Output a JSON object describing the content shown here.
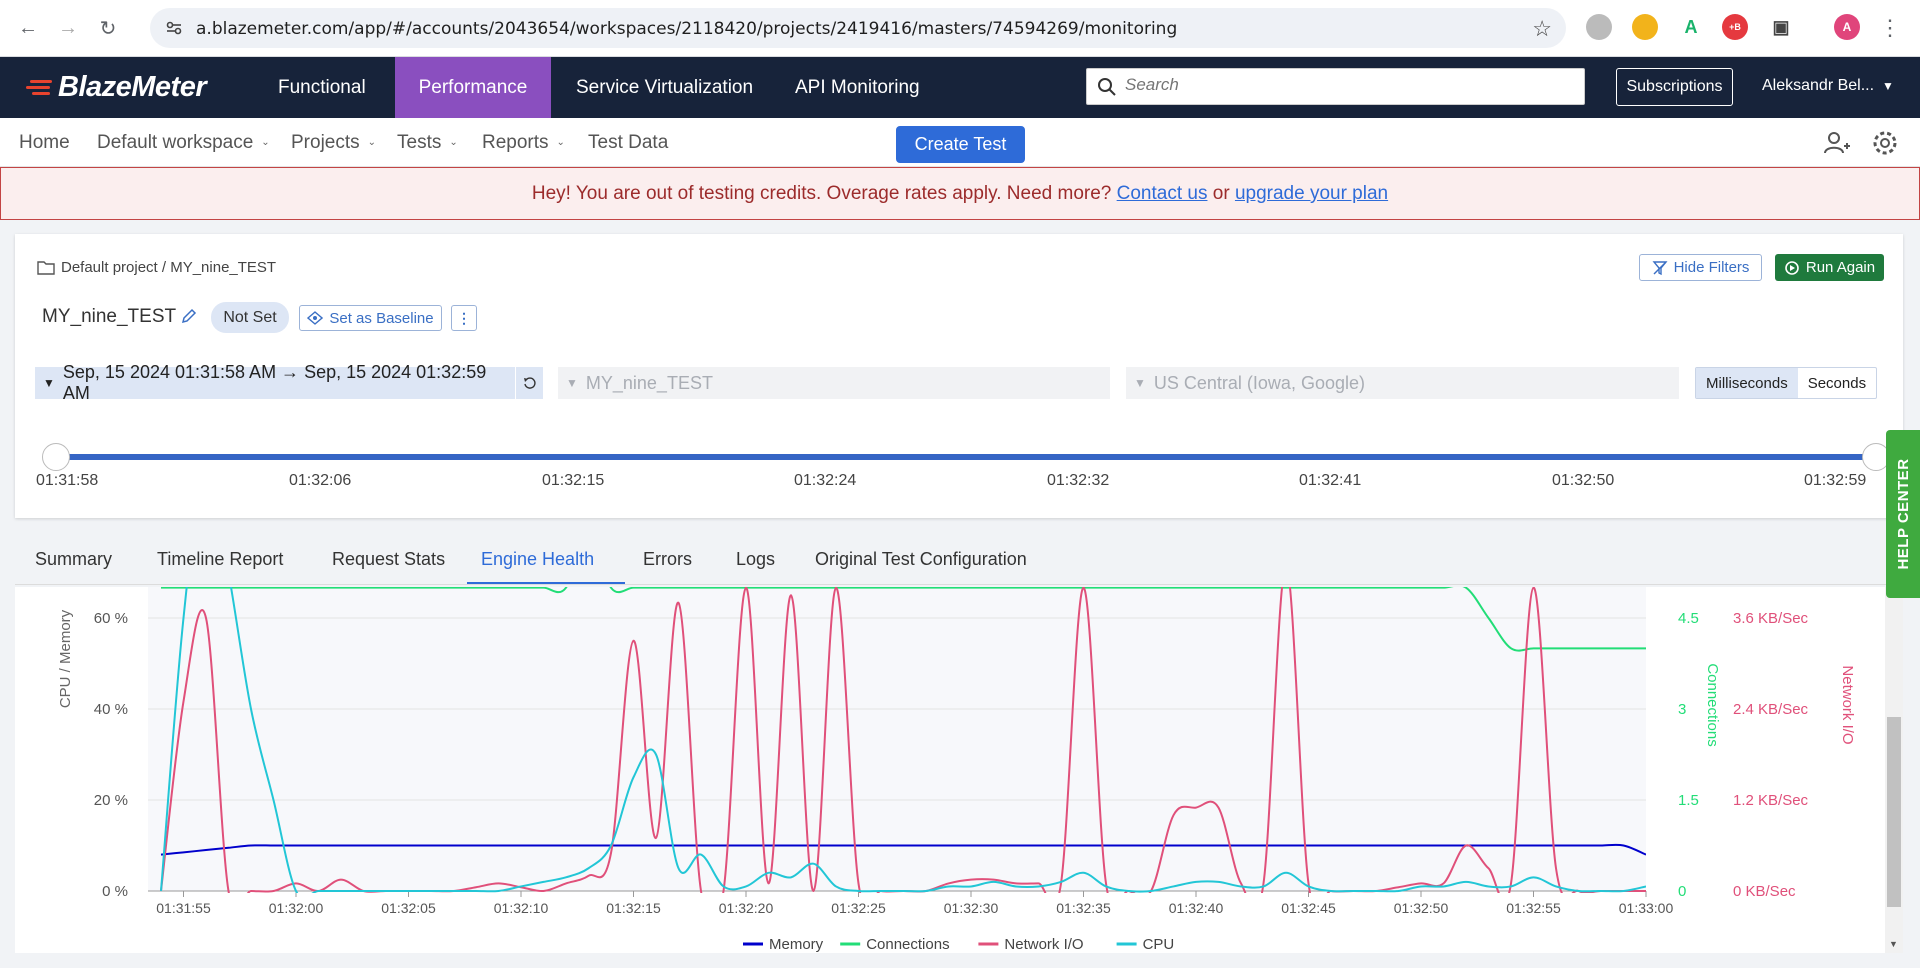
{
  "browser": {
    "url": "a.blazemeter.com/app/#/accounts/2043654/workspaces/2118420/projects/2419416/masters/74594269/monitoring",
    "profile_initial": "A"
  },
  "topnav": {
    "brand": "BlazeMeter",
    "items": [
      {
        "label": "Functional"
      },
      {
        "label": "Performance"
      },
      {
        "label": "Service Virtualization"
      },
      {
        "label": "API Monitoring"
      }
    ],
    "search_placeholder": "Search",
    "subscriptions_label": "Subscriptions",
    "user_name": "Aleksandr Bel...",
    "active_color": "#8a4fbf",
    "bg_color": "#17233a"
  },
  "subnav": {
    "home": "Home",
    "workspace": "Default workspace",
    "projects": "Projects",
    "tests": "Tests",
    "reports": "Reports",
    "test_data": "Test Data",
    "create_test": "Create Test"
  },
  "banner": {
    "text": "Hey! You are out of testing credits. Overage rates apply. Need more?",
    "contact_link": "Contact us",
    "or": "or",
    "upgrade_link": "upgrade your plan"
  },
  "test": {
    "breadcrumb": "Default project / MY_nine_TEST",
    "hide_filters": "Hide Filters",
    "run_again": "Run Again",
    "name": "MY_nine_TEST",
    "status": "Not Set",
    "set_baseline": "Set as Baseline",
    "date_range": "Sep, 15 2024 01:31:58 AM → Sep, 15 2024 01:32:59 AM",
    "scenario": "MY_nine_TEST",
    "location": "US Central (Iowa, Google)",
    "unit_ms": "Milliseconds",
    "unit_s": "Seconds",
    "slider_ticks": [
      "01:31:58",
      "01:32:06",
      "01:32:15",
      "01:32:24",
      "01:32:32",
      "01:32:41",
      "01:32:50",
      "01:32:59"
    ]
  },
  "tabs": [
    {
      "label": "Summary"
    },
    {
      "label": "Timeline Report"
    },
    {
      "label": "Request Stats"
    },
    {
      "label": "Engine Health"
    },
    {
      "label": "Errors"
    },
    {
      "label": "Logs"
    },
    {
      "label": "Original Test Configuration"
    }
  ],
  "help_center": "HELP CENTER",
  "chart_data": {
    "type": "line",
    "x": [
      "01:31:54",
      "01:31:55",
      "01:31:56",
      "01:31:57",
      "01:31:58",
      "01:31:59",
      "01:32:00",
      "01:32:01",
      "01:32:02",
      "01:32:03",
      "01:32:04",
      "01:32:05",
      "01:32:06",
      "01:32:07",
      "01:32:08",
      "01:32:09",
      "01:32:10",
      "01:32:11",
      "01:32:12",
      "01:32:13",
      "01:32:14",
      "01:32:15",
      "01:32:16",
      "01:32:17",
      "01:32:18",
      "01:32:19",
      "01:32:20",
      "01:32:21",
      "01:32:22",
      "01:32:23",
      "01:32:24",
      "01:32:25",
      "01:32:26",
      "01:32:27",
      "01:32:28",
      "01:32:29",
      "01:32:30",
      "01:32:31",
      "01:32:32",
      "01:32:33",
      "01:32:34",
      "01:32:35",
      "01:32:36",
      "01:32:37",
      "01:32:38",
      "01:32:39",
      "01:32:40",
      "01:32:41",
      "01:32:42",
      "01:32:43",
      "01:32:44",
      "01:32:45",
      "01:32:46",
      "01:32:47",
      "01:32:48",
      "01:32:49",
      "01:32:50",
      "01:32:51",
      "01:32:52",
      "01:32:53",
      "01:32:54",
      "01:32:55",
      "01:32:56",
      "01:32:57",
      "01:32:58",
      "01:32:59",
      "01:33:00"
    ],
    "x_ticks": [
      "01:31:55",
      "01:32:00",
      "01:32:05",
      "01:32:10",
      "01:32:15",
      "01:32:20",
      "01:32:25",
      "01:32:30",
      "01:32:35",
      "01:32:40",
      "01:32:45",
      "01:32:50",
      "01:32:55",
      "01:33:00"
    ],
    "y_left": {
      "label": "CPU / Memory",
      "ticks": [
        "0 %",
        "20 %",
        "40 %",
        "60 %"
      ],
      "range": [
        0,
        80
      ]
    },
    "y_right_connections": {
      "label": "Connections",
      "ticks": [
        "0",
        "1.5",
        "3",
        "4.5"
      ],
      "range": [
        0,
        6
      ]
    },
    "y_right_network": {
      "label": "Network I/O",
      "ticks": [
        "0 KB/Sec",
        "1.2 KB/Sec",
        "2.4 KB/Sec",
        "3.6 KB/Sec"
      ],
      "range": [
        0,
        4.8
      ]
    },
    "series": [
      {
        "name": "Memory",
        "color": "#0000cc",
        "axis": "left",
        "values": [
          8,
          8.5,
          9,
          9.5,
          10,
          10,
          10,
          10,
          10,
          10,
          10,
          10,
          10,
          10,
          10,
          10,
          10,
          10,
          10,
          10,
          10,
          10,
          10,
          10,
          10,
          10,
          10,
          10,
          10,
          10,
          10,
          10,
          10,
          10,
          10,
          10,
          10,
          10,
          10,
          10,
          10,
          10,
          10,
          10,
          10,
          10,
          10,
          10,
          10,
          10,
          10,
          10,
          10,
          10,
          10,
          10,
          10,
          10,
          10,
          10,
          10,
          10,
          10,
          10,
          10,
          10,
          8
        ]
      },
      {
        "name": "Connections",
        "color": "#22dd77",
        "axis": "conn",
        "values": [
          5,
          5,
          5,
          5,
          5,
          5,
          5,
          5,
          5,
          5,
          5,
          5,
          5,
          5,
          5,
          5,
          5,
          5,
          5,
          6,
          5,
          5,
          5,
          5,
          5,
          5,
          5,
          5,
          5,
          5,
          5,
          5,
          5,
          5,
          5,
          5,
          5,
          5,
          5,
          5,
          5,
          5,
          5,
          5,
          5,
          5,
          5,
          5,
          5,
          5,
          5,
          5,
          5,
          5,
          5,
          5,
          5,
          5,
          5,
          4.5,
          4,
          4,
          4,
          4,
          4,
          4,
          4
        ]
      },
      {
        "name": "Network I/O",
        "color": "#e0507a",
        "axis": "net",
        "values": [
          0,
          2.5,
          3.6,
          0,
          0,
          0,
          0.1,
          0,
          0.15,
          0,
          0,
          0,
          0,
          0,
          0.05,
          0.1,
          0.05,
          0,
          0.1,
          0.2,
          0.5,
          3.3,
          0.7,
          3.8,
          0,
          0,
          4,
          0.1,
          3.9,
          0,
          4,
          0.1,
          0,
          0,
          0,
          0.1,
          0.15,
          0.15,
          0.1,
          0.1,
          0.1,
          4,
          0.1,
          0,
          0,
          1.0,
          1.1,
          1.1,
          0.1,
          0.1,
          4.3,
          0.1,
          0,
          0,
          0,
          0.05,
          0.1,
          0.1,
          0.6,
          0.3,
          0.1,
          4,
          0.3,
          0,
          0,
          0,
          0
        ]
      },
      {
        "name": "CPU",
        "color": "#22c6d6",
        "axis": "left",
        "values": [
          0,
          60,
          95,
          70,
          40,
          20,
          0,
          0,
          0,
          0,
          0,
          0,
          0,
          0,
          0,
          0,
          1,
          2,
          3,
          5,
          10,
          25,
          30,
          5,
          8,
          1,
          1,
          4,
          3,
          6,
          1,
          0,
          0,
          0,
          0,
          1,
          1,
          2,
          1,
          1,
          2,
          4,
          1,
          0,
          0,
          1,
          2,
          2,
          1,
          1,
          4,
          1,
          0,
          0,
          0,
          0,
          1,
          1,
          2,
          1,
          1,
          3,
          1,
          0,
          0,
          0,
          1
        ]
      }
    ],
    "grid": true,
    "legend_position": "bottom"
  }
}
